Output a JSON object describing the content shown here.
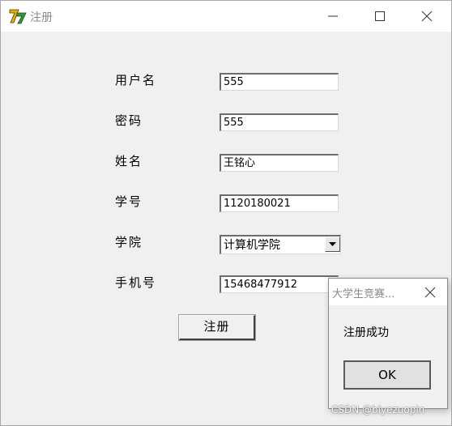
{
  "window": {
    "title": "注册",
    "controls": {
      "minimize": "minimize-icon",
      "maximize": "maximize-icon",
      "close": "close-icon"
    }
  },
  "form": {
    "username": {
      "label": "用户名",
      "value": "555"
    },
    "password": {
      "label": "密码",
      "value": "555"
    },
    "name": {
      "label": "姓名",
      "value": "王铭心"
    },
    "student_id": {
      "label": "学号",
      "value": "1120180021"
    },
    "college": {
      "label": "学院",
      "value": "计算机学院"
    },
    "phone": {
      "label": "手机号",
      "value": "15468477912"
    },
    "submit_label": "注册"
  },
  "dialog": {
    "title": "大学生竞赛...",
    "message": "注册成功",
    "ok_label": "OK"
  },
  "watermark": "CSDN @biyezuopin",
  "colors": {
    "window_bg": "#f0f0f0",
    "titlebar_bg": "#ffffff",
    "title_text": "#8a8a8a"
  }
}
